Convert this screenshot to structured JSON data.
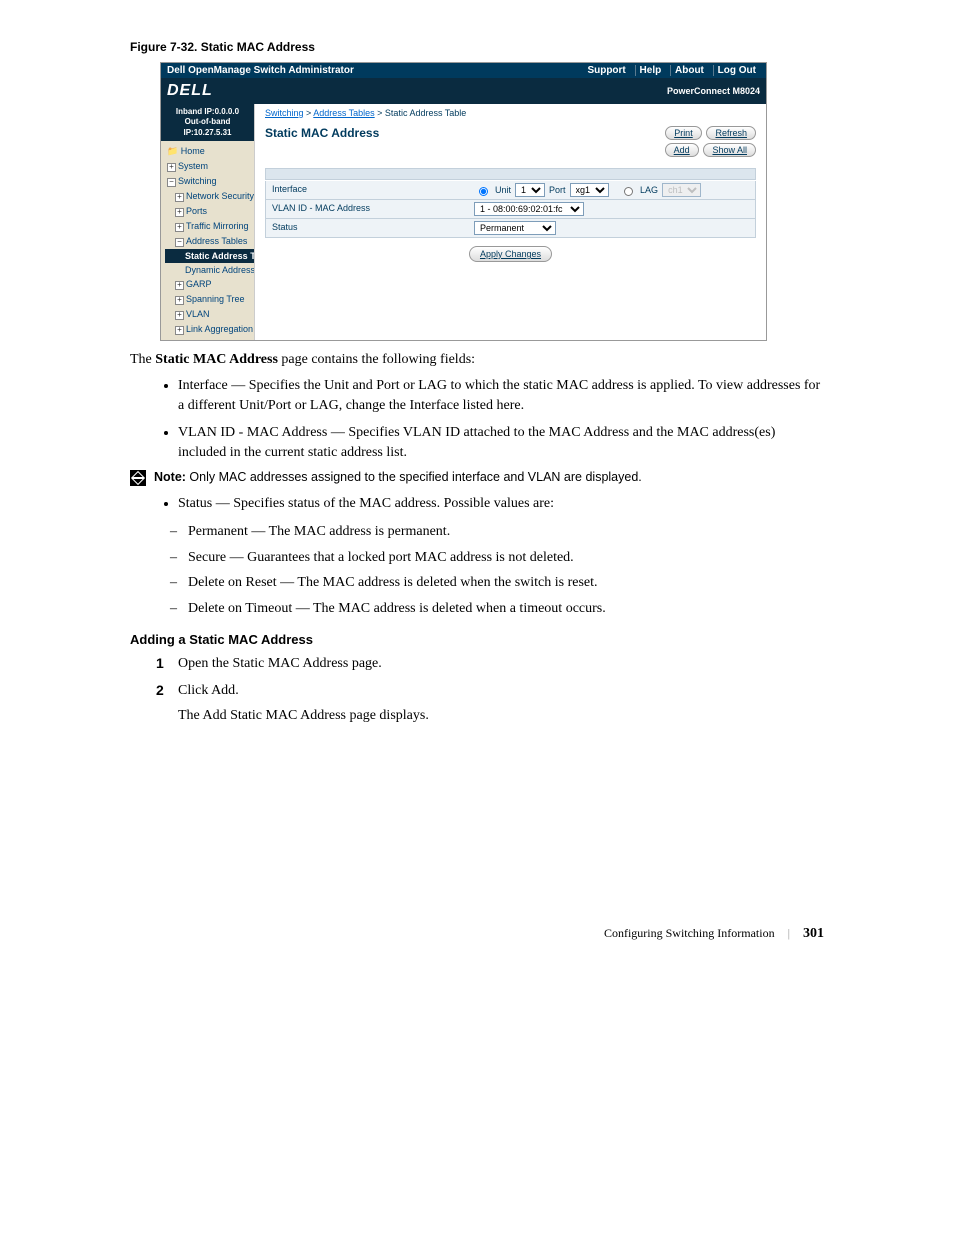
{
  "figure_caption": "Figure 7-32.    Static MAC Address",
  "screenshot": {
    "topbar": {
      "title": "Dell OpenManage Switch Administrator",
      "links": [
        "Support",
        "Help",
        "About",
        "Log Out"
      ]
    },
    "brand": {
      "logo": "DELL",
      "model": "PowerConnect M8024"
    },
    "ip": {
      "inband": "Inband IP:0.0.0.0",
      "outband": "Out-of-band IP:10.27.5.31"
    },
    "tree": {
      "home": "Home",
      "system": "System",
      "switching": "Switching",
      "network_security": "Network Security",
      "ports": "Ports",
      "traffic_mirroring": "Traffic Mirroring",
      "address_tables": "Address Tables",
      "static_address_table": "Static Address Tab",
      "dynamic_address_table": "Dynamic Address T",
      "garp": "GARP",
      "spanning_tree": "Spanning Tree",
      "vlan": "VLAN",
      "link_aggregation": "Link Aggregation"
    },
    "breadcrumb": {
      "a1": "Switching",
      "a2": "Address Tables",
      "tail": " > Static Address Table"
    },
    "main_title": "Static MAC Address",
    "buttons": {
      "print": "Print",
      "refresh": "Refresh",
      "add": "Add",
      "show_all": "Show All"
    },
    "form": {
      "interface_label": "Interface",
      "unit_label": "Unit",
      "unit_value": "1",
      "port_label": "Port",
      "port_value": "xg1",
      "lag_label": "LAG",
      "lag_value": "ch1",
      "vlan_label": "VLAN ID - MAC Address",
      "vlan_value": "1 - 08:00:69:02:01:fc",
      "status_label": "Status",
      "status_value": "Permanent"
    },
    "apply": "Apply Changes"
  },
  "intro": {
    "strong": "Static MAC Address",
    "rest": " page contains the following fields:"
  },
  "bullets": {
    "interface": {
      "term": "Interface",
      "text": " — Specifies the Unit and Port or LAG to which the static MAC address is applied. To view addresses for a different Unit/Port or LAG, change the Interface listed here."
    },
    "vlan": {
      "term": "VLAN ID - MAC Address",
      "text": " — Specifies VLAN ID attached to the MAC Address and the MAC address(es) included in the current static address list."
    }
  },
  "note": {
    "label": "Note:",
    "text": " Only MAC addresses assigned to the specified interface and VLAN are displayed."
  },
  "status_bullet": {
    "term": "Status",
    "text": " — Specifies status of the MAC address. Possible values are:"
  },
  "sub": {
    "permanent": {
      "term": "Permanent",
      "text": " — The MAC address is permanent."
    },
    "secure": {
      "term": "Secure",
      "text": " — Guarantees that a locked port MAC address is not deleted."
    },
    "reset": {
      "term": "Delete on Reset",
      "text": " — The MAC address is deleted when the switch is reset."
    },
    "timeout": {
      "term": "Delete on Timeout",
      "text": " — The MAC address is deleted when a timeout occurs."
    }
  },
  "section_heading": "Adding a Static MAC Address",
  "steps": {
    "s1a": "Open the ",
    "s1b": "Static MAC Address",
    "s1c": " page.",
    "s2a": "Click ",
    "s2b": "Add",
    "s2c": ".",
    "s2_sub_a": "The ",
    "s2_sub_b": "Add Static MAC Address",
    "s2_sub_c": " page displays."
  },
  "footer": {
    "title": "Configuring Switching Information",
    "page": "301"
  }
}
